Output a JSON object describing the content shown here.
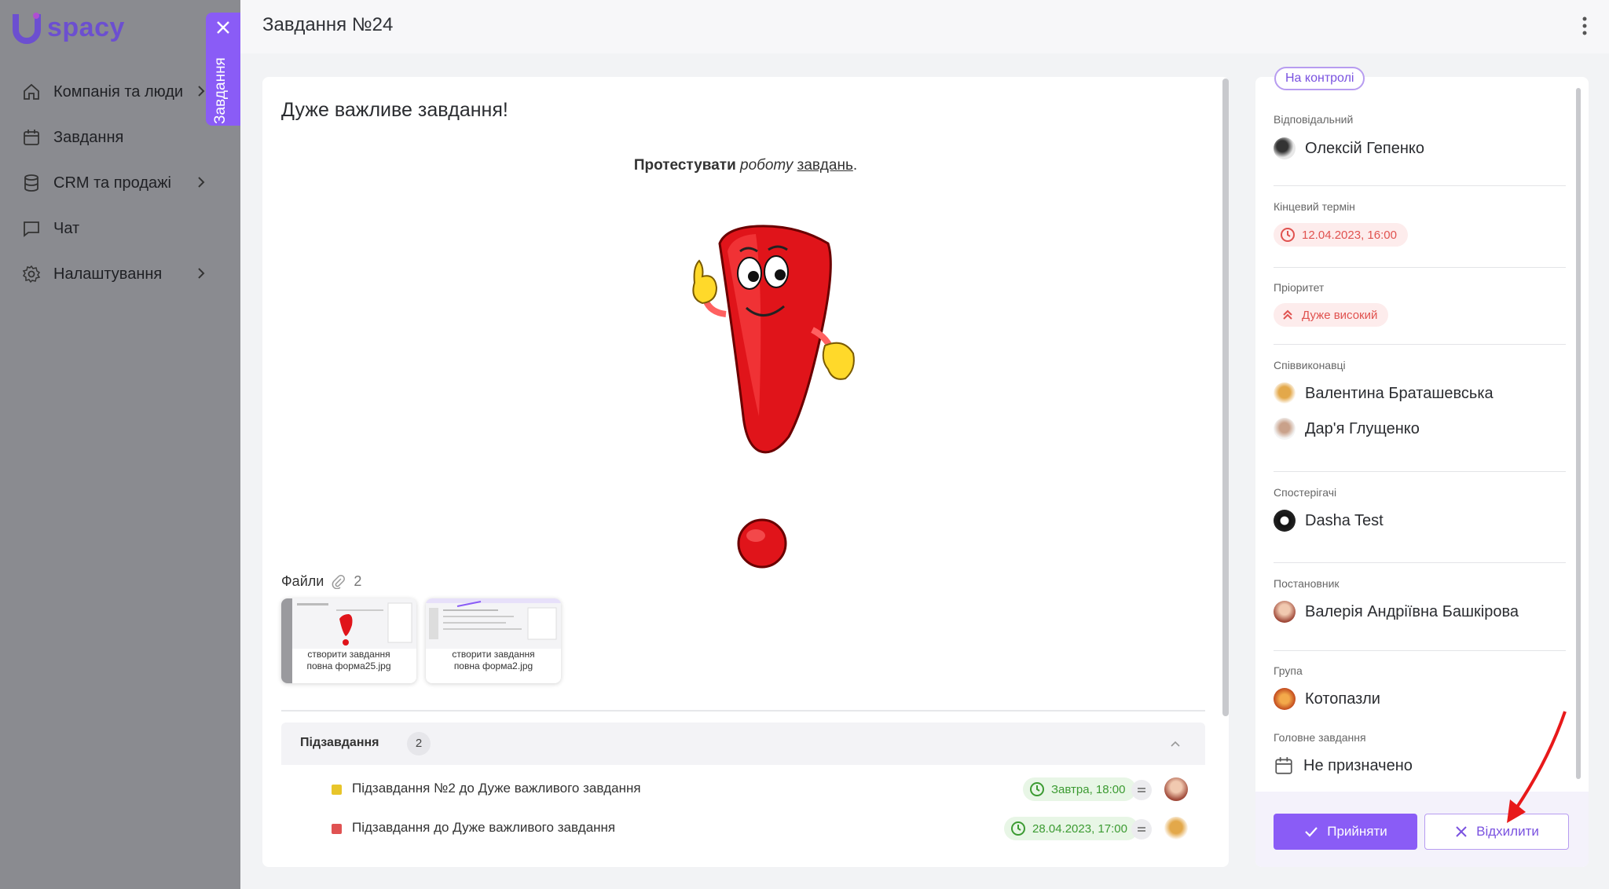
{
  "app": {
    "logo_text": "spacy",
    "logo_letter": "U"
  },
  "sidebar": {
    "items": [
      {
        "label": "Компанія та люди",
        "icon": "home-icon",
        "has_chevron": true
      },
      {
        "label": "Завдання",
        "icon": "calendar-icon",
        "has_chevron": false
      },
      {
        "label": "CRM та продажі",
        "icon": "database-icon",
        "has_chevron": true
      },
      {
        "label": "Чат",
        "icon": "chat-icon",
        "has_chevron": false
      },
      {
        "label": "Налаштування",
        "icon": "gear-icon",
        "has_chevron": true
      }
    ]
  },
  "vertical_tab": {
    "label": "Завдання"
  },
  "header": {
    "title": "Завдання №24"
  },
  "task": {
    "name": "Дуже важливе завдання!",
    "description": {
      "bold": "Протестувати",
      "italic": "роботу",
      "underline": "завдань",
      "end": "."
    }
  },
  "files": {
    "label": "Файли",
    "count": "2",
    "items": [
      {
        "line1": "створити завдання",
        "line2": "повна форма25.jpg"
      },
      {
        "line1": "створити завдання",
        "line2": "повна форма2.jpg"
      }
    ]
  },
  "subtasks": {
    "label": "Підзавдання",
    "count": "2",
    "rows": [
      {
        "name": "Підзавдання №2 до Дуже важливого завдання",
        "due": "Завтра, 18:00",
        "status_color": "#e8c52a"
      },
      {
        "name": "Підзавдання до Дуже важливого завдання",
        "due": "28.04.2023, 17:00",
        "status_color": "#e05252"
      }
    ]
  },
  "details": {
    "status": "На контролі",
    "responsible_label": "Відповідальний",
    "responsible": "Олексій Гепенко",
    "deadline_label": "Кінцевий термін",
    "deadline": "12.04.2023, 16:00",
    "priority_label": "Пріоритет",
    "priority": "Дуже високий",
    "coexecutors_label": "Співвиконавці",
    "coexecutors": [
      "Валентина Браташевська",
      "Дар'я Глущенко"
    ],
    "observers_label": "Спостерігачі",
    "observers": [
      "Dasha Test"
    ],
    "creator_label": "Постановник",
    "creator": "Валерія Андріївна Башкірова",
    "group_label": "Група",
    "group": "Котопазли",
    "parent_label": "Головне завдання",
    "parent": "Не призначено"
  },
  "actions": {
    "accept": "Прийняти",
    "reject": "Відхилити"
  },
  "colors": {
    "accent": "#8a5cf6",
    "danger": "#e0524f",
    "success": "#3c9b32"
  }
}
